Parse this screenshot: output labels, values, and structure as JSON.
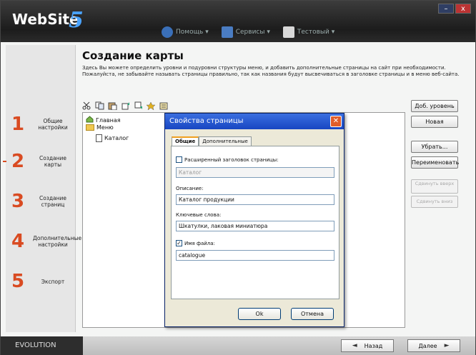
{
  "app": {
    "logo": "WebSite",
    "logo_suffix": "5"
  },
  "window_controls": {
    "minimize": "–",
    "close": "x"
  },
  "topmenu": [
    {
      "label": "Помощь ▾",
      "icon": "help-icon"
    },
    {
      "label": "Сервисы ▾",
      "icon": "save-icon"
    },
    {
      "label": "Тестовый ▾",
      "icon": "document-icon"
    }
  ],
  "steps": [
    {
      "num": "1",
      "label": "Общие настройки"
    },
    {
      "num": "2",
      "label": "Создание карты"
    },
    {
      "num": "3",
      "label": "Создание страниц"
    },
    {
      "num": "4",
      "label": "Дополнительные настройки"
    },
    {
      "num": "5",
      "label": "Экспорт"
    }
  ],
  "main": {
    "title": "Создание карты",
    "desc1": "Здесь Вы можете определить уровни и подуровни структуры меню, и добавить дополнительные страницы на сайт при необходимости.",
    "desc2": "Пожалуйста, не забывайте называть страницы правильно, так как названия будут высвечиваться в заголовке страницы и в меню веб-сайта."
  },
  "tree": {
    "home": "Главная",
    "menu": "Меню",
    "catalog": "Каталог"
  },
  "right_buttons": {
    "add_level": "Доб. уровень",
    "new": "Новая",
    "remove": "Убрать...",
    "rename": "Переименовать",
    "move_up": "Сдвинуть вверх",
    "move_down": "Сдвинуть вниз"
  },
  "dialog": {
    "title": "Свойства страницы",
    "close": "✕",
    "tab_general": "Общие",
    "tab_extra": "Дополнительные",
    "ext_header_label": "Расширенный заголовок страницы:",
    "ext_header_value": "Каталог",
    "description_label": "Описание:",
    "description_value": "Каталог продукции",
    "keywords_label": "Ключевые слова:",
    "keywords_value": "Шкатулки, лаковая миниатюра",
    "filename_label": "Имя файла:",
    "filename_value": "catalogue",
    "filename_check": "✓",
    "ok": "Ok",
    "cancel": "Отмена"
  },
  "footer": {
    "edition": "EVOLUTION",
    "back": "Назад",
    "next": "Далее",
    "back_arrow": "◄",
    "next_arrow": "►"
  }
}
